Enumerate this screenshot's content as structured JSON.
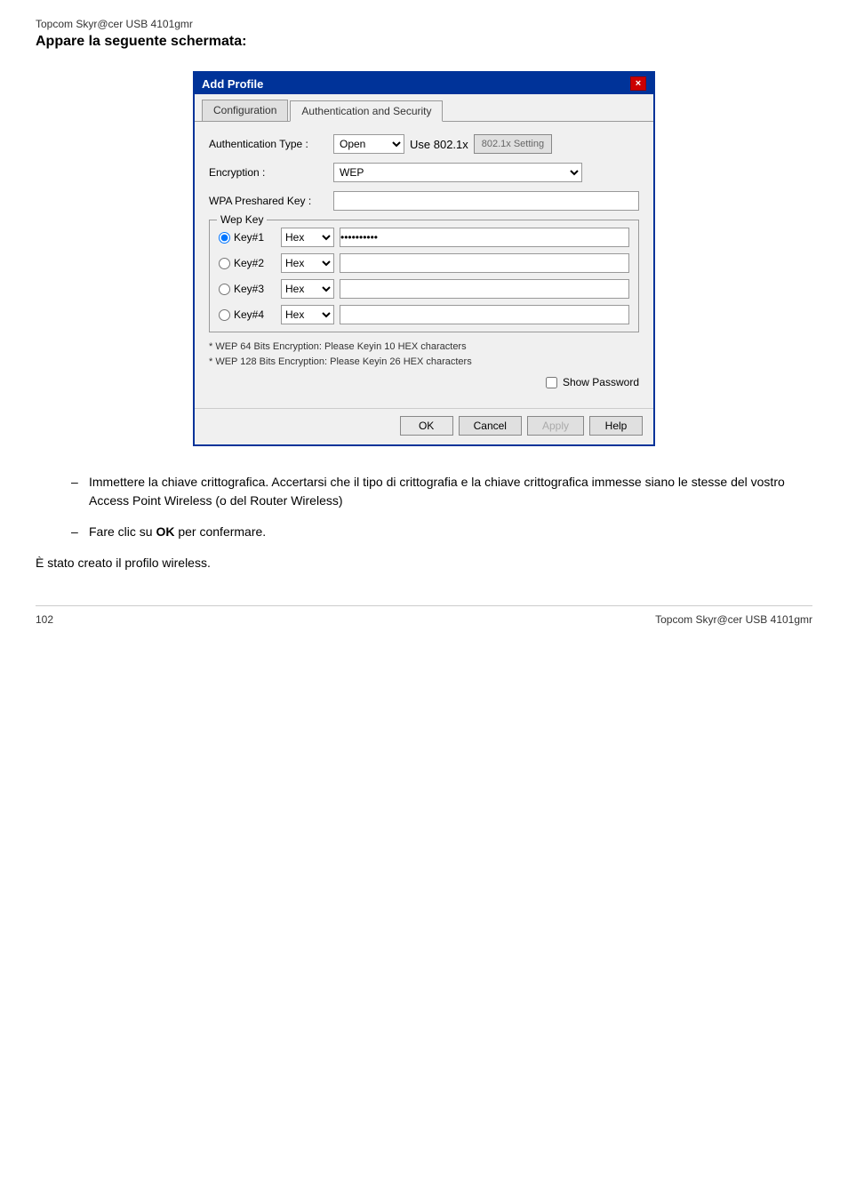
{
  "page": {
    "header_small": "Topcom Skyr@cer USB 4101gmr",
    "header_large": "Appare la seguente schermata:",
    "footer_left": "102",
    "footer_right": "Topcom Skyr@cer USB 4101gmr"
  },
  "dialog": {
    "title": "Add Profile",
    "close_icon": "×",
    "tabs": [
      {
        "label": "Configuration",
        "active": false
      },
      {
        "label": "Authentication and Security",
        "active": true
      }
    ],
    "auth_type_label": "Authentication Type :",
    "auth_type_value": "Open",
    "use_802_label": "Use 802.1x",
    "btn_802_label": "802.1x Setting",
    "encryption_label": "Encryption :",
    "encryption_value": "WEP",
    "wpa_label": "WPA Preshared Key :",
    "wpa_value": "",
    "wep_group_label": "Wep Key",
    "keys": [
      {
        "id": "key1",
        "label": "Key#1",
        "selected": true,
        "type": "Hex",
        "value": "xxxxxxxxxx"
      },
      {
        "id": "key2",
        "label": "Key#2",
        "selected": false,
        "type": "Hex",
        "value": ""
      },
      {
        "id": "key3",
        "label": "Key#3",
        "selected": false,
        "type": "Hex",
        "value": ""
      },
      {
        "id": "key4",
        "label": "Key#4",
        "selected": false,
        "type": "Hex",
        "value": ""
      }
    ],
    "hint1": "* WEP 64 Bits Encryption:   Please Keyin 10 HEX characters",
    "hint2": "* WEP 128 Bits Encryption:  Please Keyin 26 HEX characters",
    "show_password_label": "Show Password",
    "show_password_checked": false,
    "btn_ok": "OK",
    "btn_cancel": "Cancel",
    "btn_apply": "Apply",
    "btn_help": "Help"
  },
  "bullets": [
    "Immettere la chiave crittografica. Accertarsi che il tipo di crittografia e la chiave crittografica immesse siano le stesse del vostro Access Point Wireless (o del Router Wireless)",
    "Fare clic su <b>OK</b>  per confermare."
  ],
  "bullet1": "Immettere la chiave crittografica. Accertarsi che il tipo di crittografia e la chiave crittografica immesse siano le stesse del vostro Access Point Wireless (o del Router Wireless)",
  "bullet2_prefix": "Fare clic su ",
  "bullet2_bold": "OK",
  "bullet2_suffix": "  per confermare.",
  "conclusion": "È stato creato il profilo wireless."
}
